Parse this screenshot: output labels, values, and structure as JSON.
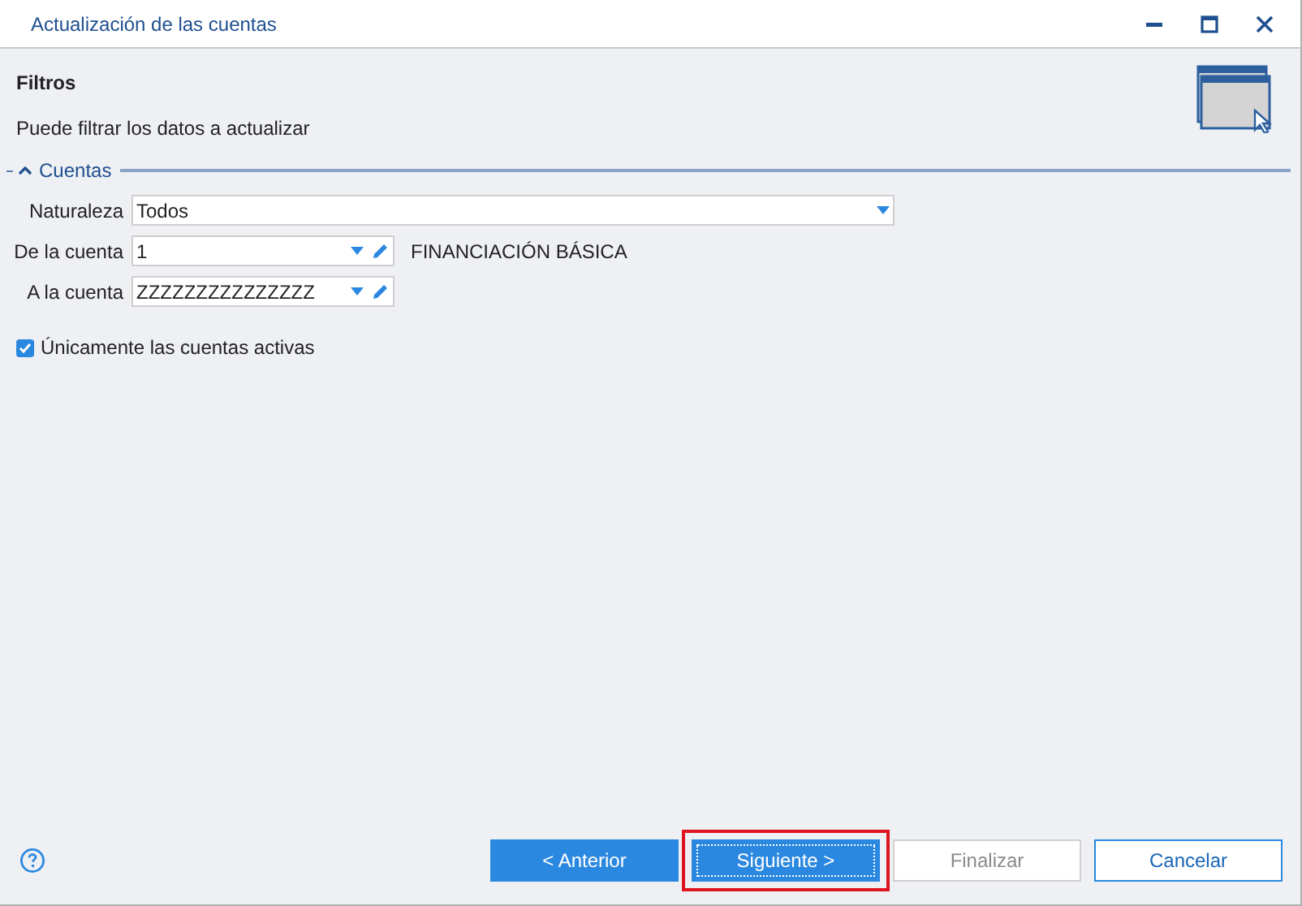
{
  "window": {
    "title": "Actualización de las cuentas"
  },
  "header": {
    "title": "Filtros",
    "subtitle": "Puede filtrar los datos a actualizar"
  },
  "group": {
    "title": "Cuentas",
    "expanded": true
  },
  "fields": [
    {
      "kind": "select",
      "label": "Naturaleza",
      "value": "Todos"
    },
    {
      "kind": "lookup",
      "label": "De la cuenta",
      "value": "1",
      "description": "FINANCIACIÓN BÁSICA"
    },
    {
      "kind": "lookup",
      "label": "A la cuenta",
      "value": "ZZZZZZZZZZZZZZZ"
    }
  ],
  "checkbox": {
    "label": "Únicamente las cuentas activas",
    "checked": true
  },
  "buttons": [
    {
      "label": "< Anterior",
      "kind": "primary",
      "highlighted": false
    },
    {
      "label": "Siguiente >",
      "kind": "focused",
      "highlighted": true
    },
    {
      "label": "Finalizar",
      "kind": "disabled",
      "highlighted": false
    },
    {
      "label": "Cancelar",
      "kind": "outline",
      "highlighted": false
    }
  ]
}
